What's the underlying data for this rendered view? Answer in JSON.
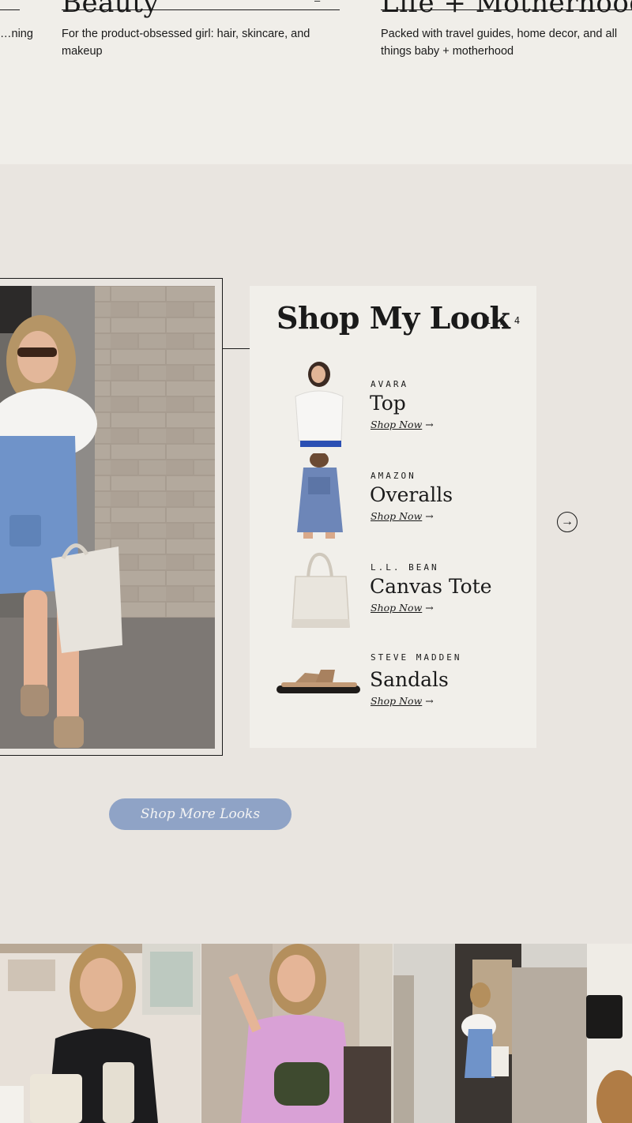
{
  "categories": [
    {
      "title": "",
      "description": "…ning",
      "count": ""
    },
    {
      "title": "Beauty",
      "description": "For the product-obsessed girl: hair, skincare, and makeup",
      "count": "—"
    },
    {
      "title": "Life + Motherhood",
      "description": "Packed with travel guides, home decor, and all things baby + motherhood",
      "count": ""
    }
  ],
  "shop_look": {
    "title": "Shop My Look",
    "counter": "1 / 4",
    "link_label": "Shop Now",
    "arrow": "→",
    "items": [
      {
        "brand": "AVARA",
        "name": "Top",
        "icon": "blouse-thumbnail"
      },
      {
        "brand": "AMAZON",
        "name": "Overalls",
        "icon": "overalls-thumbnail"
      },
      {
        "brand": "L.L. BEAN",
        "name": "Canvas Tote",
        "icon": "tote-thumbnail"
      },
      {
        "brand": "STEVE MADDEN",
        "name": "Sandals",
        "icon": "sandals-thumbnail"
      }
    ]
  },
  "next_arrow": "→",
  "more_button": "Shop More Looks",
  "colors": {
    "page_bg": "#e9e5e0",
    "strip_bg": "#f0eee9",
    "panel_bg": "#f1efea",
    "accent_button": "#8fa3c6",
    "ink": "#1a1a1a"
  }
}
